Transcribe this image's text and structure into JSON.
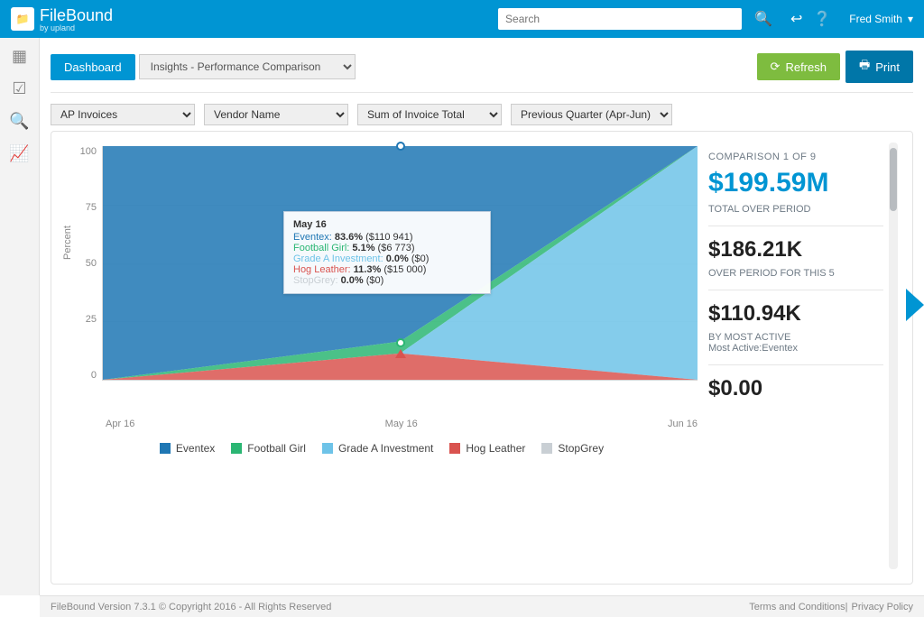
{
  "brand": {
    "name": "FileBound",
    "sub": "by upland"
  },
  "header": {
    "search_placeholder": "Search",
    "user_name": "Fred Smith"
  },
  "sidebar": {
    "items": [
      {
        "name": "apps-icon"
      },
      {
        "name": "checkbox-icon"
      },
      {
        "name": "search-icon"
      },
      {
        "name": "chart-icon",
        "active": true
      }
    ]
  },
  "toolbar": {
    "dashboard_label": "Dashboard",
    "view_value": "Insights - Performance Comparison",
    "refresh_label": "Refresh",
    "print_label": "Print"
  },
  "filters": {
    "f1": "AP Invoices",
    "f2": "Vendor Name",
    "f3": "Sum of Invoice Total",
    "f4": "Previous Quarter (Apr-Jun)"
  },
  "chart_data": {
    "type": "area",
    "title": "",
    "xlabel": "",
    "ylabel": "Percent",
    "ylim": [
      0,
      100
    ],
    "categories": [
      "Apr 16",
      "May 16",
      "Jun 16"
    ],
    "series": [
      {
        "name": "Eventex",
        "color": "#1f77b4",
        "values": [
          100,
          83.6,
          100
        ]
      },
      {
        "name": "Football Girl",
        "color": "#2bb673",
        "values": [
          0,
          5.1,
          0
        ]
      },
      {
        "name": "Grade A Investment",
        "color": "#6ec3e8",
        "values": [
          0,
          0.0,
          100
        ]
      },
      {
        "name": "Hog Leather",
        "color": "#d9534f",
        "values": [
          0,
          11.3,
          0
        ]
      },
      {
        "name": "StopGrey",
        "color": "#c9cfd4",
        "values": [
          0,
          0.0,
          0
        ]
      }
    ],
    "tooltip": {
      "title": "May 16",
      "rows": [
        {
          "label": "Eventex",
          "color": "#1f77b4",
          "pct": "83.6%",
          "val": "($110 941)"
        },
        {
          "label": "Football Girl",
          "color": "#2bb673",
          "pct": "5.1%",
          "val": "($6 773)"
        },
        {
          "label": "Grade A Investment",
          "color": "#6ec3e8",
          "pct": "0.0%",
          "val": "($0)"
        },
        {
          "label": "Hog Leather",
          "color": "#d9534f",
          "pct": "11.3%",
          "val": "($15 000)"
        },
        {
          "label": "StopGrey",
          "color": "#c9cfd4",
          "pct": "0.0%",
          "val": "($0)"
        }
      ]
    }
  },
  "stats": {
    "header": "COMPARISON 1 OF 9",
    "blocks": [
      {
        "big": "$199.59M",
        "big_color": "blue",
        "sub": "TOTAL OVER PERIOD"
      },
      {
        "big": "$186.21K",
        "big_color": "black",
        "sub": "OVER PERIOD FOR THIS 5"
      },
      {
        "big": "$110.94K",
        "big_color": "black",
        "sub": "BY MOST ACTIVE",
        "sub2": "Most Active:Eventex"
      },
      {
        "big": "$0.00",
        "big_color": "black",
        "sub": ""
      }
    ]
  },
  "footer": {
    "left": "FileBound Version 7.3.1 © Copyright 2016 - All Rights Reserved",
    "link1": "Terms and Conditions",
    "sep": " | ",
    "link2": "Privacy Policy"
  },
  "colors": {
    "series": [
      "#1f77b4",
      "#2bb673",
      "#6ec3e8",
      "#d9534f",
      "#c9cfd4"
    ]
  }
}
